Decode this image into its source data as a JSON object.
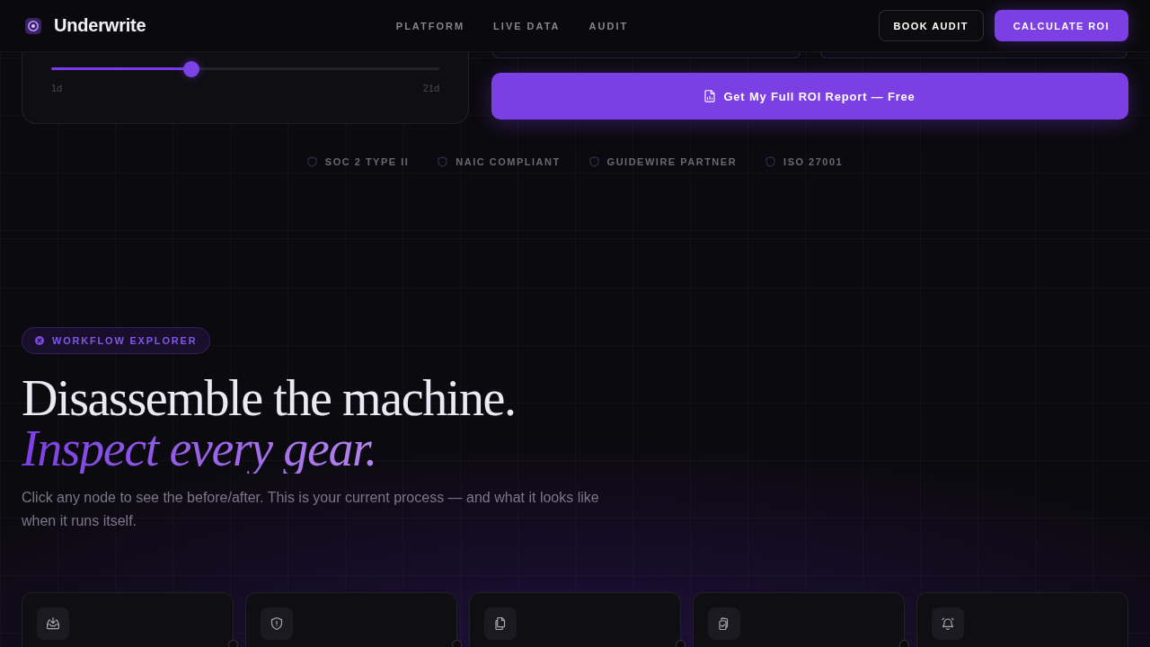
{
  "nav": {
    "brand": "Underwrite",
    "links": [
      "PLATFORM",
      "LIVE DATA",
      "AUDIT"
    ],
    "buttons": [
      {
        "label": "BOOK AUDIT",
        "kind": "outline"
      },
      {
        "label": "CALCULATE ROI",
        "kind": "primary"
      }
    ]
  },
  "calculator": {
    "slider": {
      "level": 0.36,
      "min_label": "1d",
      "max_label": "21d"
    },
    "cta": "Get My Full ROI Report — Free"
  },
  "compliance": [
    "SOC 2 TYPE II",
    "NAIC COMPLIANT",
    "GUIDEWIRE PARTNER",
    "ISO 27001"
  ],
  "workflow": {
    "badge": "WORKFLOW EXPLORER",
    "title": "Disassemble the machine.",
    "title_accent": "Inspect every gear.",
    "description": "Click any node to see the before/after. This is your current process — and what it looks like when it runs itself.",
    "nodes": [
      {
        "kind": "inbox"
      },
      {
        "kind": "shield"
      },
      {
        "kind": "copy"
      },
      {
        "kind": "clipboard"
      },
      {
        "kind": "bell"
      }
    ]
  }
}
